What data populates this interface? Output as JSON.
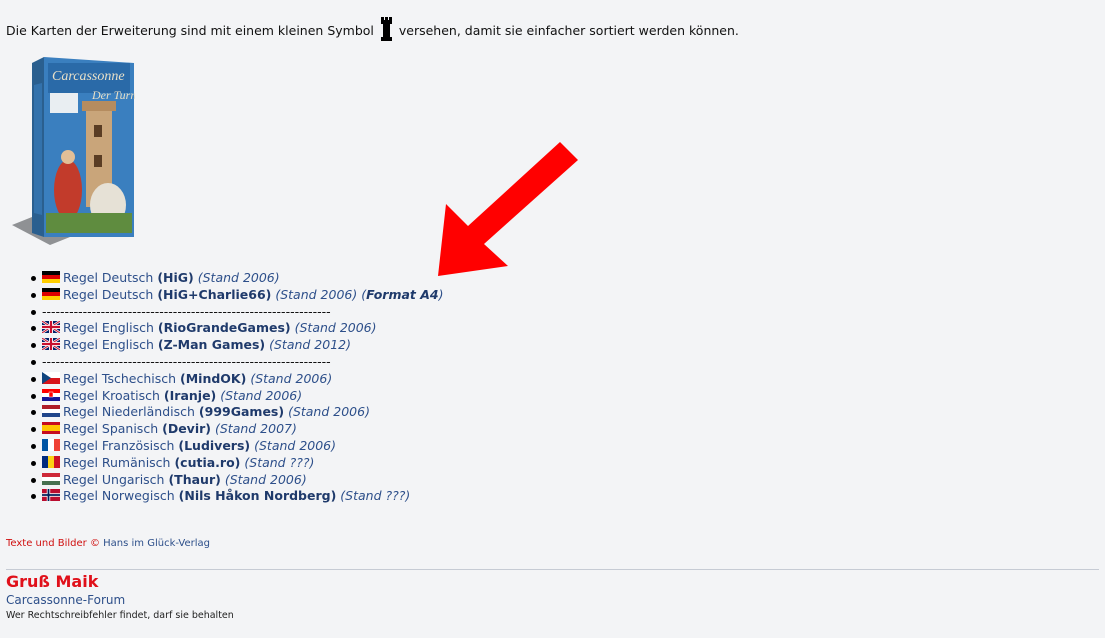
{
  "intro": {
    "before": "Die Karten der Erweiterung sind mit einem kleinen Symbol",
    "after": "versehen, damit sie einfacher sortiert werden können.",
    "symbol_icon": "tower-icon"
  },
  "box": {
    "title_text": "Carcassonne",
    "subtitle_text": "Der Turm"
  },
  "rules": [
    {
      "type": "item",
      "flag": "de",
      "label": "Regel Deutsch",
      "source": "(HiG)",
      "stand": "(Stand 2006)"
    },
    {
      "type": "item",
      "flag": "de",
      "label": "Regel Deutsch",
      "source": "(HiG+Charlie66)",
      "stand": "(Stand 2006)",
      "format_open": "(",
      "format": "Format A4",
      "format_close": ")"
    },
    {
      "type": "sep",
      "text": "----------------------------------------------------------------"
    },
    {
      "type": "item",
      "flag": "gb",
      "label": "Regel Englisch",
      "source": "(RioGrandeGames)",
      "stand": "(Stand 2006)"
    },
    {
      "type": "item",
      "flag": "gb",
      "label": "Regel Englisch",
      "source": "(Z-Man Games)",
      "stand": "(Stand 2012)"
    },
    {
      "type": "sep",
      "text": "----------------------------------------------------------------"
    },
    {
      "type": "item",
      "flag": "cz",
      "label": "Regel Tschechisch",
      "source": "(MindOK)",
      "stand": "(Stand 2006)"
    },
    {
      "type": "item",
      "flag": "hr",
      "label": "Regel Kroatisch",
      "source": "(Iranje)",
      "stand": "(Stand 2006)"
    },
    {
      "type": "item",
      "flag": "nl",
      "label": "Regel Niederländisch",
      "source": "(999Games)",
      "stand": "(Stand 2006)"
    },
    {
      "type": "item",
      "flag": "es",
      "label": "Regel Spanisch",
      "source": "(Devir)",
      "stand": "(Stand 2007)"
    },
    {
      "type": "item",
      "flag": "fr",
      "label": "Regel Französisch",
      "source": "(Ludivers)",
      "stand": "(Stand 2006)"
    },
    {
      "type": "item",
      "flag": "ro",
      "label": "Regel Rumänisch",
      "source": "(cutia.ro)",
      "stand": "(Stand ???)"
    },
    {
      "type": "item",
      "flag": "hu",
      "label": "Regel Ungarisch",
      "source": "(Thaur)",
      "stand": "(Stand 2006)"
    },
    {
      "type": "item",
      "flag": "no",
      "label": "Regel Norwegisch",
      "source": "(Nils Håkon Nordberg)",
      "stand": "(Stand ???)"
    }
  ],
  "credit": {
    "prefix": "Texte und Bilder ©",
    "owner": "Hans im Glück-Verlag"
  },
  "signature": {
    "name": "Gruß Maik",
    "forum": "Carcassonne-Forum",
    "note": "Wer Rechtschreibfehler findet, darf sie behalten"
  },
  "colors": {
    "link": "#2d4f8a",
    "link_bold": "#1f3a6b",
    "signature_red": "#e0101a",
    "arrow_red": "#ff0000",
    "background": "#f3f4f6"
  }
}
